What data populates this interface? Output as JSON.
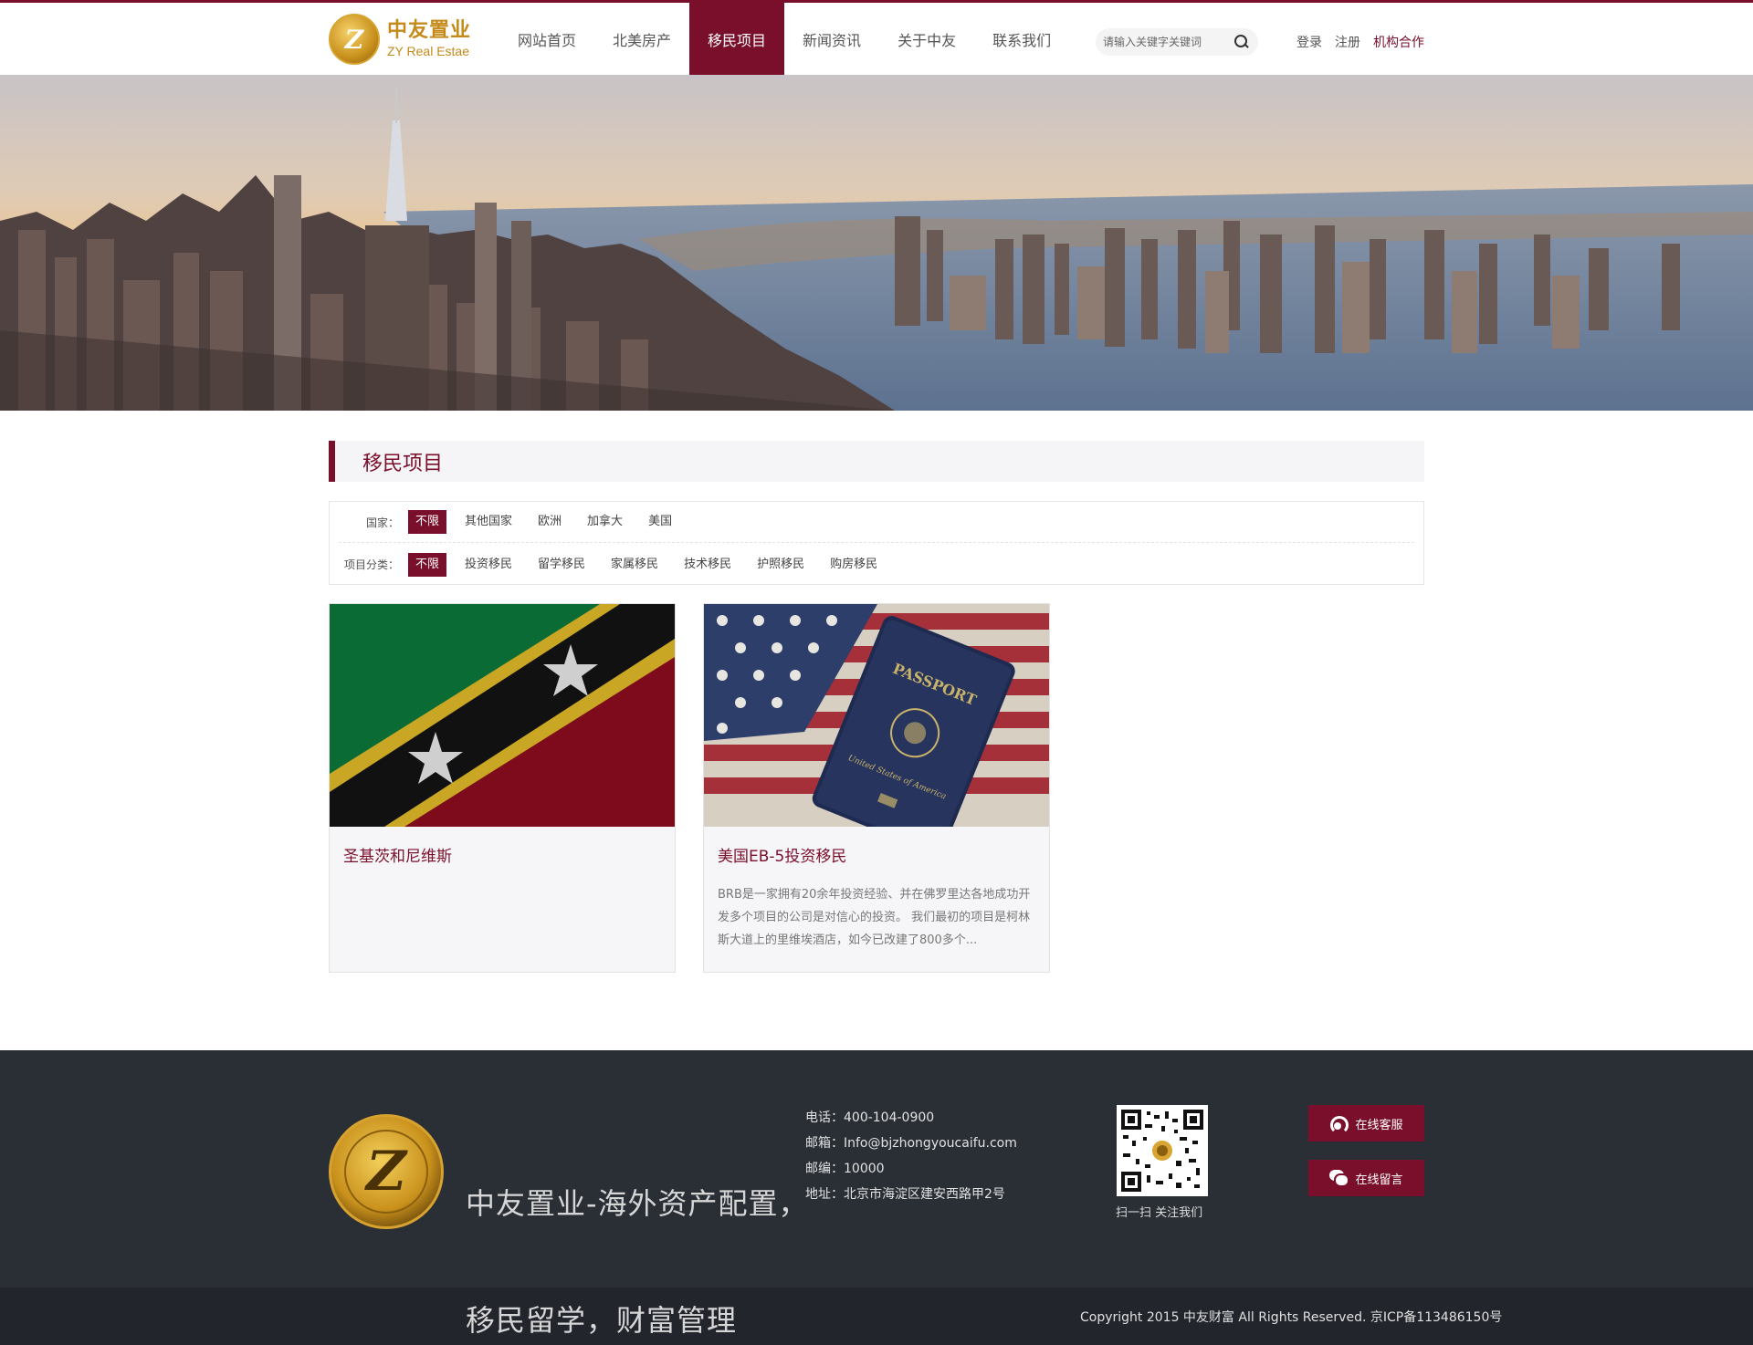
{
  "header": {
    "logo_cn": "中友置业",
    "logo_en": "ZY Real Estae",
    "nav": [
      "网站首页",
      "北美房产",
      "移民项目",
      "新闻资讯",
      "关于中友",
      "联系我们"
    ],
    "active_nav": "移民项目",
    "search_placeholder": "请输入关键字关键词",
    "login": "登录",
    "register": "注册",
    "partner": "机构合作"
  },
  "section": {
    "title": "移民项目"
  },
  "filter": {
    "country_label": "国家：",
    "countries": [
      "不限",
      "其他国家",
      "欧洲",
      "加拿大",
      "美国"
    ],
    "category_label": "项目分类：",
    "categories": [
      "不限",
      "投资移民",
      "留学移民",
      "家属移民",
      "技术移民",
      "护照移民",
      "购房移民"
    ]
  },
  "cards": [
    {
      "title": "圣基茨和尼维斯",
      "desc": ""
    },
    {
      "title": "美国EB-5投资移民",
      "desc": "BRB是一家拥有20余年投资经验、并在佛罗里达各地成功开发多个项目的公司是对信心的投资。 我们最初的项目是柯林斯大道上的里维埃酒店，如今已改建了800多个..."
    }
  ],
  "passport_text": {
    "title": "PASSPORT",
    "country": "United States of America"
  },
  "footer": {
    "slogan": "中友置业-海外资产配置，移民留学，财富管理",
    "phone": "电话：400-104-0900",
    "email": "邮箱：Info@bjzhongyoucaifu.com",
    "zip": "邮编：10000",
    "address": "地址：北京市海淀区建安西路甲2号",
    "qr_caption": "扫一扫 关注我们",
    "btn_service": "在线客服",
    "btn_message": "在线留言",
    "copyright": "Copyright 2015 中友财富 All Rights Reserved. 京ICP备113486150号"
  },
  "colors": {
    "brand": "#7a0f2b",
    "gold": "#c48a1a",
    "footer_bg": "#2a2f36"
  }
}
